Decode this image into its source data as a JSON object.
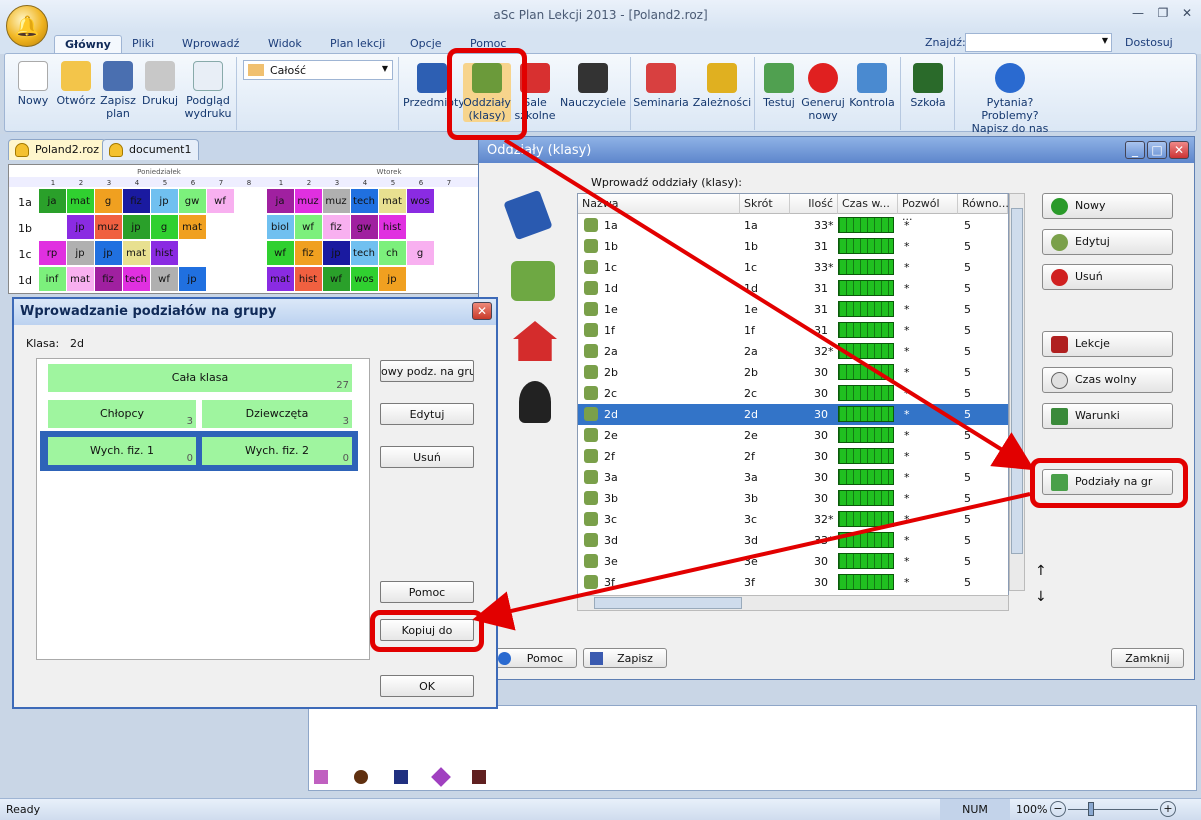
{
  "window": {
    "title": "aSc Plan Lekcji 2013  - [Poland2.roz]",
    "search_label": "Znajdź:",
    "customize": "Dostosuj"
  },
  "ribbon_tabs": [
    "Główny",
    "Pliki",
    "Wprowadź",
    "Widok",
    "Plan lekcji",
    "Opcje",
    "Pomoc"
  ],
  "toolbar": {
    "new": "Nowy",
    "open": "Otwórz",
    "save": "Zapisz",
    "save2": "plan",
    "print": "Drukuj",
    "preview": "Podgląd",
    "preview2": "wydruku",
    "view_select": "Całość",
    "subjects": "Przedmioty",
    "classes": "Oddziały",
    "classes2": "(klasy)",
    "rooms": "Sale",
    "rooms2": "szkolne",
    "teachers": "Nauczyciele",
    "seminars": "Seminaria",
    "dependencies": "Zależności",
    "test": "Testuj",
    "generate": "Generuj",
    "generate2": "nowy",
    "control": "Kontrola",
    "school": "Szkoła",
    "help": "Pytania? Problemy?",
    "help2": "Napisz do nas"
  },
  "doc_tabs": [
    "Poland2.roz",
    "document1"
  ],
  "timetable": {
    "day1": "Poniedziałek",
    "day2": "Wtorek",
    "periods": [
      "1",
      "2",
      "3",
      "4",
      "5",
      "6",
      "7",
      "8"
    ],
    "rows": [
      "1a",
      "1b",
      "1c",
      "1d"
    ],
    "lessons1": [
      [
        "ja",
        "mat",
        "g",
        "fiz",
        "jp",
        "gw",
        "wf",
        ""
      ],
      [
        "",
        "jp",
        "muz",
        "jp",
        "g",
        "mat",
        "",
        ""
      ],
      [
        "rp",
        "jp",
        "jp",
        "mat",
        "hist",
        "",
        ""
      ],
      [
        "inf",
        "mat",
        "fiz",
        "tech",
        "wf",
        "jp",
        "",
        ""
      ]
    ],
    "lessons2": [
      [
        "ja",
        "muz",
        "muz",
        "tech",
        "mat",
        "wos",
        ""
      ],
      [
        "biol",
        "wf",
        "fiz",
        "gw",
        "hist",
        "",
        ""
      ],
      [
        "wf",
        "fiz",
        "jp",
        "tech",
        "ch",
        "g",
        ""
      ],
      [
        "mat",
        "hist",
        "wf",
        "wos",
        "jp",
        "",
        ""
      ]
    ]
  },
  "classes_dialog": {
    "title": "Oddziały (klasy)",
    "prompt": "Wprowadź oddziały (klasy):",
    "columns": [
      "Nazwa",
      "Skrót",
      "Ilość",
      "Czas w...",
      "Pozwól ...",
      "Równo..."
    ],
    "rows": [
      [
        "1a",
        "1a",
        "33*",
        "*",
        "5"
      ],
      [
        "1b",
        "1b",
        "31",
        "*",
        "5"
      ],
      [
        "1c",
        "1c",
        "33*",
        "*",
        "5"
      ],
      [
        "1d",
        "1d",
        "31",
        "*",
        "5"
      ],
      [
        "1e",
        "1e",
        "31",
        "*",
        "5"
      ],
      [
        "1f",
        "1f",
        "31",
        "*",
        "5"
      ],
      [
        "2a",
        "2a",
        "32*",
        "*",
        "5"
      ],
      [
        "2b",
        "2b",
        "30",
        "*",
        "5"
      ],
      [
        "2c",
        "2c",
        "30",
        "*",
        "5"
      ],
      [
        "2d",
        "2d",
        "30",
        "*",
        "5"
      ],
      [
        "2e",
        "2e",
        "30",
        "*",
        "5"
      ],
      [
        "2f",
        "2f",
        "30",
        "*",
        "5"
      ],
      [
        "3a",
        "3a",
        "30",
        "*",
        "5"
      ],
      [
        "3b",
        "3b",
        "30",
        "*",
        "5"
      ],
      [
        "3c",
        "3c",
        "32*",
        "*",
        "5"
      ],
      [
        "3d",
        "3d",
        "33*",
        "*",
        "5"
      ],
      [
        "3e",
        "3e",
        "30",
        "*",
        "5"
      ],
      [
        "3f",
        "3f",
        "30",
        "*",
        "5"
      ]
    ],
    "buttons": {
      "new": "Nowy",
      "edit": "Edytuj",
      "delete": "Usuń",
      "lessons": "Lekcje",
      "free_time": "Czas wolny",
      "conditions": "Warunki",
      "groups": "Podziały na gr",
      "help": "Pomoc",
      "save": "Zapisz",
      "close": "Zamknij"
    }
  },
  "groups_dialog": {
    "title": "Wprowadzanie podziałów na grupy",
    "class_label": "Klasa:",
    "class_value": "2d",
    "whole": "Cała klasa",
    "whole_n": "27",
    "boys": "Chłopcy",
    "boys_n": "3",
    "girls": "Dziewczęta",
    "girls_n": "3",
    "pe1": "Wych. fiz. 1",
    "pe1_n": "0",
    "pe2": "Wych. fiz. 2",
    "pe2_n": "0",
    "buttons": {
      "new": "owy podz. na grup",
      "edit": "Edytuj",
      "delete": "Usuń",
      "help": "Pomoc",
      "copy": "Kopiuj do",
      "ok": "OK"
    }
  },
  "status": {
    "ready": "Ready",
    "num": "NUM",
    "zoom": "100%"
  },
  "colors": {
    "highlight": "#e20000",
    "selection": "#3374c8"
  }
}
